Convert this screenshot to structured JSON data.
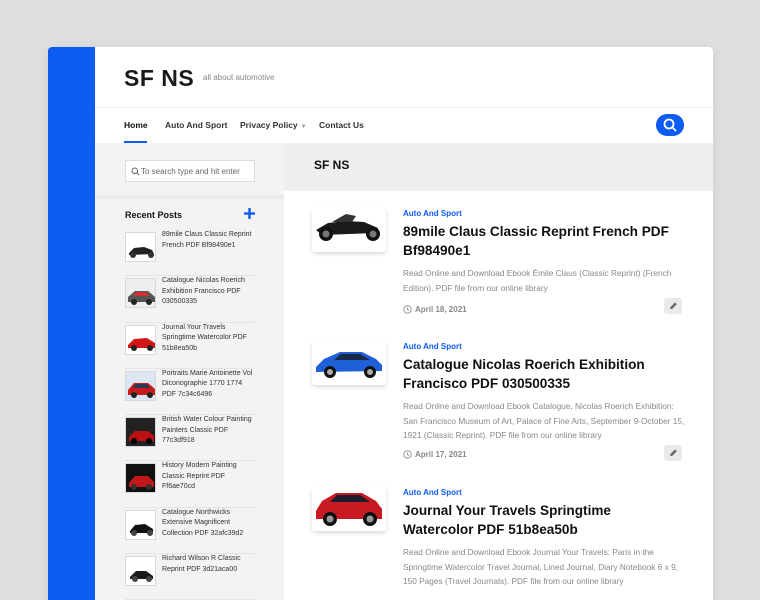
{
  "site": {
    "title": "SF NS",
    "tagline": "all about automotive",
    "accent": "#0f5cf0"
  },
  "nav": {
    "items": [
      {
        "label": "Home",
        "active": true
      },
      {
        "label": "Auto And Sport"
      },
      {
        "label": "Privacy Policy",
        "has_dropdown": true
      },
      {
        "label": "Contact Us"
      }
    ],
    "search_icon": "search-icon"
  },
  "sidebar": {
    "search_placeholder": "To search type and hit enter",
    "recent_title": "Recent Posts",
    "add_icon": "plus-icon",
    "recent_posts": [
      {
        "text": "89mile Claus Classic Reprint French PDF Bf98490e1"
      },
      {
        "text": "Catalogue Nicolas Roerich Exhibition Francisco PDF 030500335"
      },
      {
        "text": "Journal Your Travels Springtime Watercolor PDF 51b8ea50b"
      },
      {
        "text": "Portraits Marie Antoinette Vol Diconographie 1770 1774 PDF 7c34c6496"
      },
      {
        "text": "British Water Colour Painting Painters Classic PDF 77c3df918"
      },
      {
        "text": "History Modern Painting Classic Reprint PDF Ff6ae70cd"
      },
      {
        "text": "Catalogue Northwicks Extensive Magnificent Collection PDF 32afc39d2"
      },
      {
        "text": "Richard Wilson R Classic Reprint PDF 3d21aca00"
      }
    ]
  },
  "main": {
    "heading": "SF NS",
    "articles": [
      {
        "category": "Auto And Sport",
        "title": "89mile Claus Classic Reprint French PDF Bf98490e1",
        "excerpt": "Read Online and Download Ebook Émile Claus (Classic Reprint) (French Edition). PDF file from our online library",
        "date": "April 18, 2021",
        "image": "motorcycle"
      },
      {
        "category": "Auto And Sport",
        "title": "Catalogue Nicolas Roerich Exhibition Francisco PDF 030500335",
        "excerpt": "Read Online and Download Ebook Catalogue, Nicolas Roerich Exhibition: San Francisco Museum of Art, Palace of Fine Arts, September 9-October 15, 1921 (Classic Reprint). PDF file from our online library",
        "date": "April 17, 2021",
        "image": "blue-sedan"
      },
      {
        "category": "Auto And Sport",
        "title": "Journal Your Travels Springtime Watercolor PDF 51b8ea50b",
        "excerpt": "Read Online and Download Ebook Journal Your Travels: Paris in the Springtime Watercolor Travel Journal, Lined Journal, Diary Notebook 6 x 9, 150 Pages (Travel Journals). PDF file from our online library",
        "date": "",
        "image": "red-suv"
      }
    ]
  }
}
